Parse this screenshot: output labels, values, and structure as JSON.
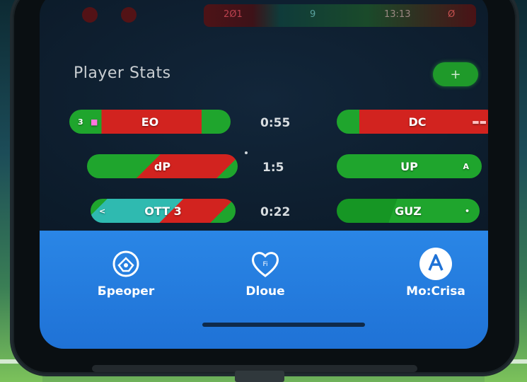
{
  "header": {
    "strip": [
      "2Ø1",
      "9",
      "13:13",
      "Ø"
    ]
  },
  "panel": {
    "title": "Player Stats",
    "toggle_label": "+"
  },
  "rows": [
    {
      "left": {
        "label": "EO",
        "prefix": "3",
        "prefix2": "■"
      },
      "center": "0:55",
      "right": {
        "label": "DC",
        "suffix": "▬▬"
      }
    },
    {
      "left": {
        "label": "dP"
      },
      "center": "1:5",
      "right": {
        "label": "UP",
        "suffix": "A"
      }
    },
    {
      "left": {
        "label": "OTT 3",
        "prefix": "<"
      },
      "center": "0:22",
      "right": {
        "label": "GUZ",
        "suffix": "•"
      }
    }
  ],
  "bottom_nav": [
    {
      "label": "Бpeoper",
      "icon": "shield-ball-icon"
    },
    {
      "label": "Dloue",
      "icon": "heart-icon"
    },
    {
      "label": "Mo:Crisa",
      "icon": "avatar-a-icon"
    }
  ],
  "colors": {
    "green": "#1fa52d",
    "red": "#d2231f",
    "teal": "#2fbab0",
    "nav_blue": "#2a86e6"
  }
}
